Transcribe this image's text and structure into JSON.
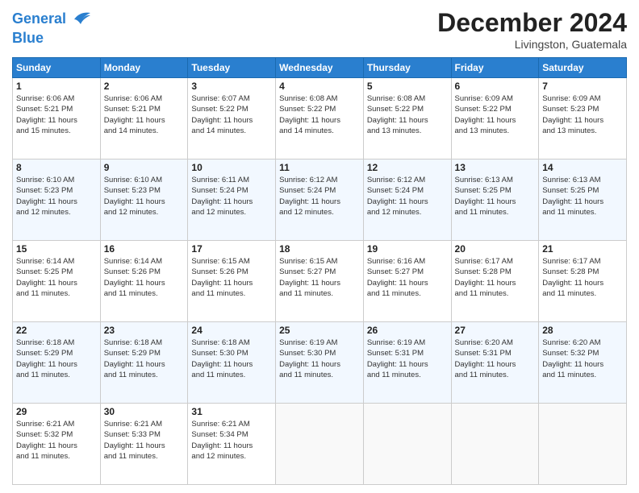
{
  "logo": {
    "line1": "General",
    "line2": "Blue"
  },
  "header": {
    "month": "December 2024",
    "location": "Livingston, Guatemala"
  },
  "weekdays": [
    "Sunday",
    "Monday",
    "Tuesday",
    "Wednesday",
    "Thursday",
    "Friday",
    "Saturday"
  ],
  "weeks": [
    [
      {
        "day": "1",
        "info": "Sunrise: 6:06 AM\nSunset: 5:21 PM\nDaylight: 11 hours\nand 15 minutes."
      },
      {
        "day": "2",
        "info": "Sunrise: 6:06 AM\nSunset: 5:21 PM\nDaylight: 11 hours\nand 14 minutes."
      },
      {
        "day": "3",
        "info": "Sunrise: 6:07 AM\nSunset: 5:22 PM\nDaylight: 11 hours\nand 14 minutes."
      },
      {
        "day": "4",
        "info": "Sunrise: 6:08 AM\nSunset: 5:22 PM\nDaylight: 11 hours\nand 14 minutes."
      },
      {
        "day": "5",
        "info": "Sunrise: 6:08 AM\nSunset: 5:22 PM\nDaylight: 11 hours\nand 13 minutes."
      },
      {
        "day": "6",
        "info": "Sunrise: 6:09 AM\nSunset: 5:22 PM\nDaylight: 11 hours\nand 13 minutes."
      },
      {
        "day": "7",
        "info": "Sunrise: 6:09 AM\nSunset: 5:23 PM\nDaylight: 11 hours\nand 13 minutes."
      }
    ],
    [
      {
        "day": "8",
        "info": "Sunrise: 6:10 AM\nSunset: 5:23 PM\nDaylight: 11 hours\nand 12 minutes."
      },
      {
        "day": "9",
        "info": "Sunrise: 6:10 AM\nSunset: 5:23 PM\nDaylight: 11 hours\nand 12 minutes."
      },
      {
        "day": "10",
        "info": "Sunrise: 6:11 AM\nSunset: 5:24 PM\nDaylight: 11 hours\nand 12 minutes."
      },
      {
        "day": "11",
        "info": "Sunrise: 6:12 AM\nSunset: 5:24 PM\nDaylight: 11 hours\nand 12 minutes."
      },
      {
        "day": "12",
        "info": "Sunrise: 6:12 AM\nSunset: 5:24 PM\nDaylight: 11 hours\nand 12 minutes."
      },
      {
        "day": "13",
        "info": "Sunrise: 6:13 AM\nSunset: 5:25 PM\nDaylight: 11 hours\nand 11 minutes."
      },
      {
        "day": "14",
        "info": "Sunrise: 6:13 AM\nSunset: 5:25 PM\nDaylight: 11 hours\nand 11 minutes."
      }
    ],
    [
      {
        "day": "15",
        "info": "Sunrise: 6:14 AM\nSunset: 5:25 PM\nDaylight: 11 hours\nand 11 minutes."
      },
      {
        "day": "16",
        "info": "Sunrise: 6:14 AM\nSunset: 5:26 PM\nDaylight: 11 hours\nand 11 minutes."
      },
      {
        "day": "17",
        "info": "Sunrise: 6:15 AM\nSunset: 5:26 PM\nDaylight: 11 hours\nand 11 minutes."
      },
      {
        "day": "18",
        "info": "Sunrise: 6:15 AM\nSunset: 5:27 PM\nDaylight: 11 hours\nand 11 minutes."
      },
      {
        "day": "19",
        "info": "Sunrise: 6:16 AM\nSunset: 5:27 PM\nDaylight: 11 hours\nand 11 minutes."
      },
      {
        "day": "20",
        "info": "Sunrise: 6:17 AM\nSunset: 5:28 PM\nDaylight: 11 hours\nand 11 minutes."
      },
      {
        "day": "21",
        "info": "Sunrise: 6:17 AM\nSunset: 5:28 PM\nDaylight: 11 hours\nand 11 minutes."
      }
    ],
    [
      {
        "day": "22",
        "info": "Sunrise: 6:18 AM\nSunset: 5:29 PM\nDaylight: 11 hours\nand 11 minutes."
      },
      {
        "day": "23",
        "info": "Sunrise: 6:18 AM\nSunset: 5:29 PM\nDaylight: 11 hours\nand 11 minutes."
      },
      {
        "day": "24",
        "info": "Sunrise: 6:18 AM\nSunset: 5:30 PM\nDaylight: 11 hours\nand 11 minutes."
      },
      {
        "day": "25",
        "info": "Sunrise: 6:19 AM\nSunset: 5:30 PM\nDaylight: 11 hours\nand 11 minutes."
      },
      {
        "day": "26",
        "info": "Sunrise: 6:19 AM\nSunset: 5:31 PM\nDaylight: 11 hours\nand 11 minutes."
      },
      {
        "day": "27",
        "info": "Sunrise: 6:20 AM\nSunset: 5:31 PM\nDaylight: 11 hours\nand 11 minutes."
      },
      {
        "day": "28",
        "info": "Sunrise: 6:20 AM\nSunset: 5:32 PM\nDaylight: 11 hours\nand 11 minutes."
      }
    ],
    [
      {
        "day": "29",
        "info": "Sunrise: 6:21 AM\nSunset: 5:32 PM\nDaylight: 11 hours\nand 11 minutes."
      },
      {
        "day": "30",
        "info": "Sunrise: 6:21 AM\nSunset: 5:33 PM\nDaylight: 11 hours\nand 11 minutes."
      },
      {
        "day": "31",
        "info": "Sunrise: 6:21 AM\nSunset: 5:34 PM\nDaylight: 11 hours\nand 12 minutes."
      },
      {
        "day": "",
        "info": ""
      },
      {
        "day": "",
        "info": ""
      },
      {
        "day": "",
        "info": ""
      },
      {
        "day": "",
        "info": ""
      }
    ]
  ]
}
